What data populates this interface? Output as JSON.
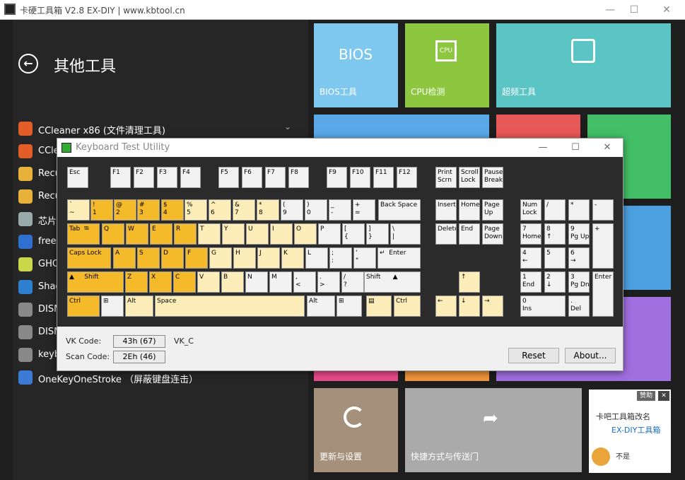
{
  "window": {
    "title": "卡硬工具箱 V2.8  EX-DIY   |  www.kbtool.cn",
    "min": "—",
    "max": "☐",
    "close": "✕"
  },
  "left": {
    "page_title": "其他工具",
    "back_icon": "←",
    "items": [
      {
        "label": "CCleaner x86 (文件清理工具)",
        "color": "#e35d28",
        "chev": "⌄"
      },
      {
        "label": "CCle",
        "color": "#e35d28",
        "chev": ""
      },
      {
        "label": "Recu",
        "color": "#e8b23a",
        "chev": ""
      },
      {
        "label": "Recu",
        "color": "#e8b23a",
        "chev": ""
      },
      {
        "label": "芯片",
        "color": "#9aa",
        "chev": ""
      },
      {
        "label": "freeg",
        "color": "#2e6fd0",
        "chev": ""
      },
      {
        "label": "GHO",
        "color": "#c9d84a",
        "chev": ""
      },
      {
        "label": "Shad",
        "color": "#2d7fd0",
        "chev": ""
      },
      {
        "label": "DISM",
        "color": "#888",
        "chev": ""
      },
      {
        "label": "DISM",
        "color": "#888",
        "chev": ""
      },
      {
        "label": "keyb",
        "color": "#888",
        "chev": ""
      },
      {
        "label": "OneKeyOneStroke （屏蔽键盘连击）",
        "color": "#3b7bd6",
        "chev": ""
      }
    ]
  },
  "tiles": [
    {
      "label": "BIOS工具",
      "icon": "BIOS",
      "color": "#7ec8f0"
    },
    {
      "label": "CPU检测",
      "icon": "CPU",
      "color": "#8dc63f"
    },
    {
      "label": "超频工具",
      "icon": "sliders",
      "color": "#5bc4c4"
    },
    {
      "label": "更新与设置",
      "icon": "refresh",
      "color": "#a5907c"
    },
    {
      "label": "快捷方式与传送门",
      "icon": "share",
      "color": "#aaaaaa"
    }
  ],
  "ad": {
    "close": "✕",
    "tag": "赞助",
    "line1": "卡吧工具箱改名",
    "line2": "EX-DIY工具箱",
    "line3": "不是"
  },
  "kbwin": {
    "title": "Keyboard Test Utility",
    "min": "—",
    "max": "☐",
    "close": "✕",
    "vk_label": "VK Code:",
    "vk_value": "43h (67)",
    "vk_name": "VK_C",
    "scan_label": "Scan Code:",
    "scan_value": "2Eh (46)",
    "reset": "Reset",
    "about": "About..."
  },
  "keys": [
    [
      "Esc",
      "n"
    ],
    [
      "F1",
      "n"
    ],
    [
      "F2",
      "n"
    ],
    [
      "F3",
      "n"
    ],
    [
      "F4",
      "n"
    ],
    [
      "F5",
      "n"
    ],
    [
      "F6",
      "n"
    ],
    [
      "F7",
      "n"
    ],
    [
      "F8",
      "n"
    ],
    [
      "F9",
      "n"
    ],
    [
      "F10",
      "n"
    ],
    [
      "F11",
      "n"
    ],
    [
      "F12",
      "n"
    ],
    [
      "Print\nScrn",
      "n"
    ],
    [
      "Scroll\nLock",
      "n"
    ],
    [
      "Pause\nBreak",
      "n"
    ],
    [
      "`\n~",
      "h"
    ],
    [
      "!\n1",
      "p"
    ],
    [
      "@\n2",
      "p"
    ],
    [
      "#\n3",
      "p"
    ],
    [
      "$\n4",
      "p"
    ],
    [
      "%\n5",
      "h"
    ],
    [
      "^\n6",
      "h"
    ],
    [
      "&\n7",
      "h"
    ],
    [
      "*\n8",
      "h"
    ],
    [
      "(\n9",
      "n"
    ],
    [
      ")\n0",
      "n"
    ],
    [
      "_\n-",
      "n"
    ],
    [
      "+\n=",
      "n"
    ],
    [
      "Back Space",
      "n"
    ],
    [
      "Insert",
      "n"
    ],
    [
      "Home",
      "n"
    ],
    [
      "Page\nUp",
      "n"
    ],
    [
      "Num\nLock",
      "n"
    ],
    [
      "/",
      "n"
    ],
    [
      "*",
      "n"
    ],
    [
      "-",
      "n"
    ],
    [
      "Tab  ⭾",
      "p"
    ],
    [
      "Q",
      "p"
    ],
    [
      "W",
      "p"
    ],
    [
      "E",
      "p"
    ],
    [
      "R",
      "p"
    ],
    [
      "T",
      "h"
    ],
    [
      "Y",
      "h"
    ],
    [
      "U",
      "h"
    ],
    [
      "I",
      "h"
    ],
    [
      "O",
      "h"
    ],
    [
      "P",
      "n"
    ],
    [
      "[\n{",
      "n"
    ],
    [
      "]\n}",
      "n"
    ],
    [
      "\\\n|",
      "n"
    ],
    [
      "Delete",
      "n"
    ],
    [
      "End",
      "n"
    ],
    [
      "Page\nDown",
      "n"
    ],
    [
      "7\nHome",
      "n"
    ],
    [
      "8\n↑",
      "n"
    ],
    [
      "9\nPg Up",
      "n"
    ],
    [
      "+",
      "n"
    ],
    [
      "Caps Lock",
      "p"
    ],
    [
      "A",
      "p"
    ],
    [
      "S",
      "p"
    ],
    [
      "D",
      "p"
    ],
    [
      "F",
      "p"
    ],
    [
      "G",
      "h"
    ],
    [
      "H",
      "h"
    ],
    [
      "J",
      "h"
    ],
    [
      "K",
      "h"
    ],
    [
      "L",
      "n"
    ],
    [
      ";\n:",
      "n"
    ],
    [
      "'\n\"",
      "n"
    ],
    [
      "↵  Enter",
      "n"
    ],
    [
      "4\n←",
      "n"
    ],
    [
      "5",
      "n"
    ],
    [
      "6\n→",
      "n"
    ],
    [
      "▲     Shift",
      "p"
    ],
    [
      "Z",
      "p"
    ],
    [
      "X",
      "p"
    ],
    [
      "C",
      "p"
    ],
    [
      "V",
      "h"
    ],
    [
      "B",
      "h"
    ],
    [
      "N",
      "n"
    ],
    [
      "M",
      "n"
    ],
    [
      ",\n<",
      "n"
    ],
    [
      ".\n>",
      "n"
    ],
    [
      "/\n?",
      "n"
    ],
    [
      "Shift      ▲",
      "n"
    ],
    [
      "↑",
      "h"
    ],
    [
      "1\nEnd",
      "n"
    ],
    [
      "2\n↓",
      "n"
    ],
    [
      "3\nPg Dn",
      "n"
    ],
    [
      "Enter",
      "n"
    ],
    [
      "Ctrl",
      "p"
    ],
    [
      "⊞",
      "n"
    ],
    [
      "Alt",
      "h"
    ],
    [
      "Space",
      "h"
    ],
    [
      "Alt",
      "n"
    ],
    [
      "⊞",
      "n"
    ],
    [
      "▤",
      "h"
    ],
    [
      "Ctrl",
      "h"
    ],
    [
      "←",
      "h"
    ],
    [
      "↓",
      "h"
    ],
    [
      "→",
      "h"
    ],
    [
      "0\nIns",
      "n"
    ],
    [
      ".\nDel",
      "n"
    ]
  ]
}
